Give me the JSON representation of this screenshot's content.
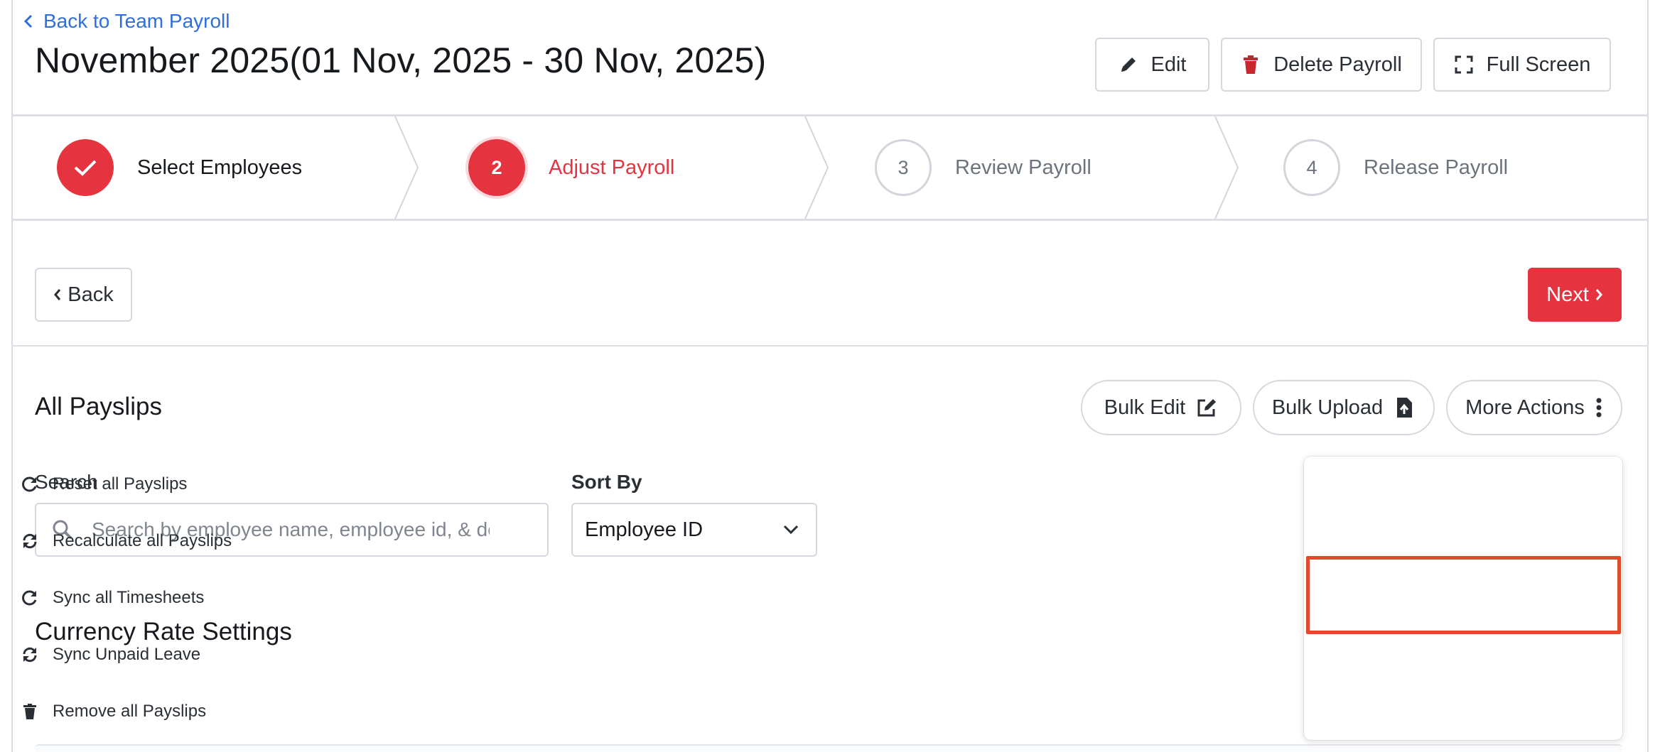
{
  "header": {
    "back_link": "Back to Team Payroll",
    "title": "November 2025(01 Nov, 2025 - 30 Nov, 2025)",
    "buttons": {
      "edit": "Edit",
      "delete": "Delete Payroll",
      "full_screen": "Full Screen"
    }
  },
  "stepper": {
    "steps": [
      {
        "number": "",
        "label": "Select Employees",
        "state": "done"
      },
      {
        "number": "2",
        "label": "Adjust Payroll",
        "state": "active"
      },
      {
        "number": "3",
        "label": "Review Payroll",
        "state": "todo"
      },
      {
        "number": "4",
        "label": "Release Payroll",
        "state": "todo"
      }
    ]
  },
  "nav": {
    "back": "Back",
    "next": "Next"
  },
  "payslips": {
    "title": "All Payslips",
    "actions": {
      "bulk_edit": "Bulk Edit",
      "bulk_upload": "Bulk Upload",
      "more_actions": "More Actions"
    },
    "search": {
      "label": "Search",
      "placeholder": "Search by employee name, employee id, & department"
    },
    "sort": {
      "label": "Sort By",
      "value": "Employee ID"
    }
  },
  "currency": {
    "title": "Currency Rate Settings"
  },
  "more_actions_menu": {
    "items": [
      {
        "label": "Reset all Payslips",
        "icon": "redo-icon"
      },
      {
        "label": "Recalculate all Payslips",
        "icon": "sync-icon"
      },
      {
        "label": "Sync all Timesheets",
        "icon": "redo-icon",
        "highlighted": true
      },
      {
        "label": "Sync Unpaid Leave",
        "icon": "sync-icon"
      },
      {
        "label": "Remove all Payslips",
        "icon": "trash-icon"
      }
    ]
  },
  "colors": {
    "accent": "#e5343f",
    "link": "#2f6fdd",
    "highlight_box": "#e04b2c",
    "border": "#d5d9df"
  }
}
